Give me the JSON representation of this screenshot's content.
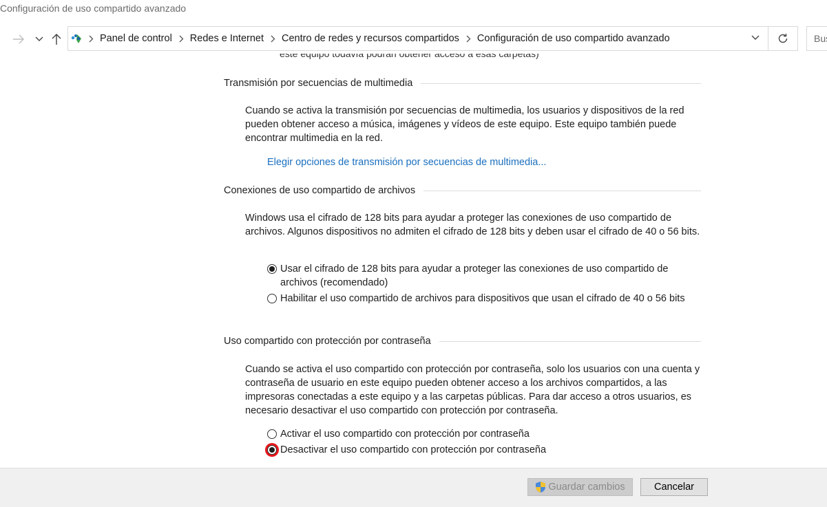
{
  "window": {
    "title": "Configuración de uso compartido avanzado"
  },
  "nav": {
    "breadcrumbs": [
      "Panel de control",
      "Redes e Internet",
      "Centro de redes y recursos compartidos",
      "Configuración de uso compartido avanzado"
    ],
    "search_placeholder": "Bus"
  },
  "content": {
    "cut_text": "este equipo todavía podrán obtener acceso a esas carpetas)",
    "sections": [
      {
        "title": "Transmisión por secuencias de multimedia",
        "description": "Cuando se activa la transmisión por secuencias de multimedia, los usuarios y dispositivos de la red pueden obtener acceso a música, imágenes y vídeos de este equipo. Este equipo también puede encontrar multimedia en la red.",
        "link": "Elegir opciones de transmisión por secuencias de multimedia..."
      },
      {
        "title": "Conexiones de uso compartido de archivos",
        "description": "Windows usa el cifrado de 128 bits para ayudar a proteger las conexiones de uso compartido de archivos. Algunos dispositivos no admiten el cifrado de 128 bits y deben usar el cifrado de 40 o 56 bits.",
        "options": [
          {
            "label": "Usar el cifrado de 128 bits para ayudar a proteger las conexiones de uso compartido de archivos (recomendado)",
            "checked": true
          },
          {
            "label": "Habilitar el uso compartido de archivos para dispositivos que usan el cifrado de 40 o 56 bits",
            "checked": false
          }
        ]
      },
      {
        "title": "Uso compartido con protección por contraseña",
        "description": "Cuando se activa el uso compartido con protección por contraseña, solo los usuarios con una cuenta y contraseña de usuario en este equipo pueden obtener acceso a los archivos compartidos, a las impresoras conectadas a este equipo y a las carpetas públicas. Para dar acceso a otros usuarios, es necesario desactivar el uso compartido con protección por contraseña.",
        "options": [
          {
            "label": "Activar el uso compartido con protección por contraseña",
            "checked": false
          },
          {
            "label": "Desactivar el uso compartido con protección por contraseña",
            "checked": true
          }
        ]
      }
    ]
  },
  "footer": {
    "save_label": "Guardar cambios",
    "cancel_label": "Cancelar"
  },
  "colors": {
    "link": "#1a6fbf",
    "highlight": "#e8161c"
  }
}
